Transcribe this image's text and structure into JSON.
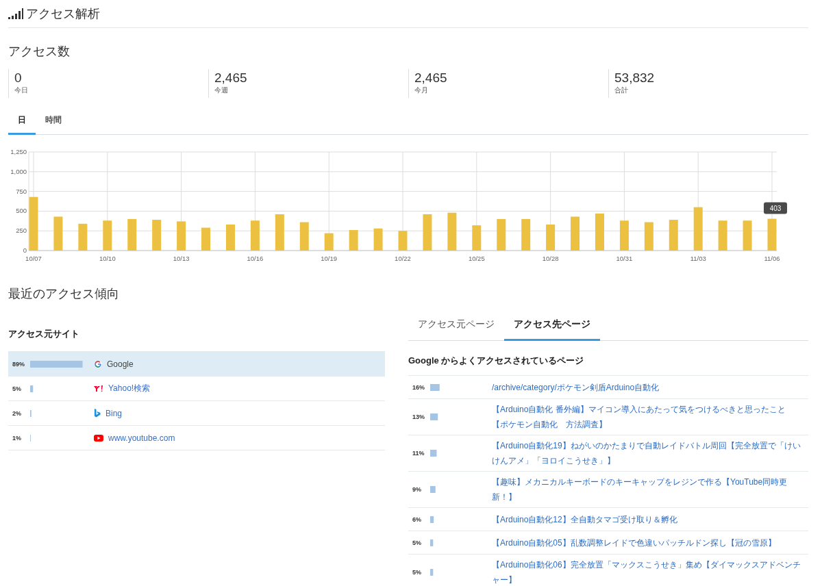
{
  "header": {
    "title": "アクセス解析"
  },
  "access_count": {
    "heading": "アクセス数",
    "stats": [
      {
        "value": "0",
        "label": "今日"
      },
      {
        "value": "2,465",
        "label": "今週"
      },
      {
        "value": "2,465",
        "label": "今月"
      },
      {
        "value": "53,832",
        "label": "合計"
      }
    ]
  },
  "chart_tabs": [
    {
      "label": "日",
      "selected": true
    },
    {
      "label": "時間",
      "selected": false
    }
  ],
  "chart_data": {
    "type": "bar",
    "grid": true,
    "categories": [
      "10/07",
      null,
      null,
      "10/10",
      null,
      null,
      "10/13",
      null,
      null,
      "10/16",
      null,
      null,
      "10/19",
      null,
      null,
      "10/22",
      null,
      null,
      "10/25",
      null,
      null,
      "10/28",
      null,
      null,
      "10/31",
      null,
      null,
      "11/03",
      null,
      null,
      "11/06"
    ],
    "series": [
      {
        "color": "#ecc141",
        "values": [
          680,
          430,
          340,
          380,
          400,
          390,
          370,
          290,
          330,
          380,
          460,
          360,
          220,
          260,
          280,
          250,
          460,
          480,
          320,
          400,
          400,
          330,
          430,
          470,
          380,
          360,
          390,
          550,
          380,
          380,
          403
        ]
      }
    ],
    "ylim": [
      0,
      1250
    ],
    "yticks": [
      {
        "value": 0,
        "label": "0"
      },
      {
        "value": 250,
        "label": "250"
      },
      {
        "value": 500,
        "label": "500"
      },
      {
        "value": 750,
        "label": "750"
      },
      {
        "value": 1000,
        "label": "1,000"
      },
      {
        "value": 1250,
        "label": "1,250"
      }
    ],
    "annotations": [
      {
        "x": "11/06",
        "y": 403,
        "text": "403"
      }
    ]
  },
  "trends": {
    "heading": "最近のアクセス傾向",
    "sources": {
      "heading": "アクセス元サイト",
      "items": [
        {
          "share": "89%",
          "level": 0.89,
          "kind": "google",
          "name": "Google",
          "selected": true
        },
        {
          "share": "5%",
          "level": 0.05,
          "kind": "yahoo",
          "name": "Yahoo!検索",
          "selected": false
        },
        {
          "share": "2%",
          "level": 0.02,
          "kind": "bing",
          "name": "Bing",
          "selected": false
        },
        {
          "share": "1%",
          "level": 0.01,
          "kind": "youtube",
          "name": "www.youtube.com",
          "selected": false
        }
      ]
    },
    "page_tabs": [
      {
        "label": "アクセス元ページ",
        "selected": false
      },
      {
        "label": "アクセス先ページ",
        "selected": true
      }
    ],
    "pages": {
      "heading": "Google からよくアクセスされているページ",
      "items": [
        {
          "share": "16%",
          "level": 0.16,
          "title": "/archive/category/ポケモン剣盾Arduino自動化"
        },
        {
          "share": "13%",
          "level": 0.13,
          "title": "【Arduino自動化 番外編】マイコン導入にあたって気をつけるべきと思ったこと【ポケモン自動化　方法調査】"
        },
        {
          "share": "11%",
          "level": 0.11,
          "title": "【Arduino自動化19】ねがいのかたまりで自動レイドバトル周回【完全放置で「けいけんアメ」「ヨロイこうせき」】"
        },
        {
          "share": "9%",
          "level": 0.09,
          "title": "【趣味】メカニカルキーボードのキーキャップをレジンで作る【YouTube同時更新！】"
        },
        {
          "share": "6%",
          "level": 0.06,
          "title": "【Arduino自動化12】全自動タマゴ受け取り＆孵化"
        },
        {
          "share": "5%",
          "level": 0.05,
          "title": "【Arduino自動化05】乱数調整レイドで色違いパッチルドン探し【冠の雪原】"
        },
        {
          "share": "5%",
          "level": 0.05,
          "title": "【Arduino自動化06】完全放置「マックスこうせき」集め【ダイマックスアドベンチャー】"
        }
      ]
    }
  }
}
